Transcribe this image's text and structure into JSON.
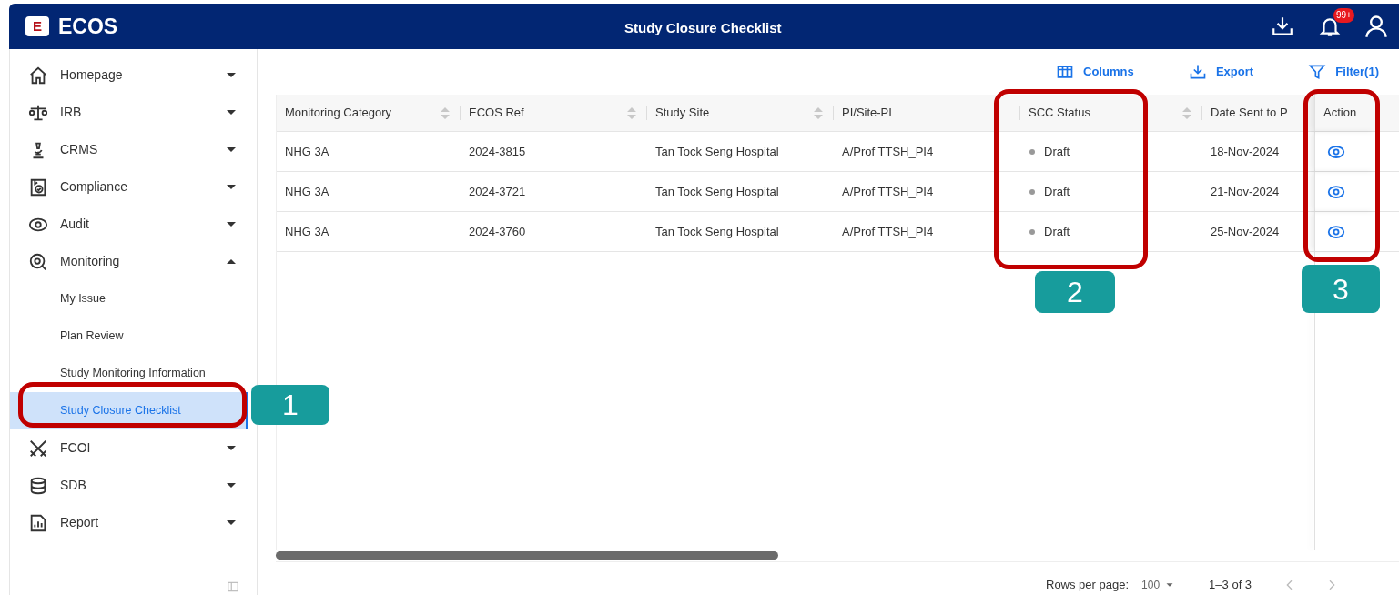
{
  "app": {
    "logo_letter": "E",
    "name": "ECOS",
    "title": "Study Closure Checklist",
    "notifications": "99+"
  },
  "sidebar": {
    "items": [
      {
        "label": "Homepage",
        "expanded": false
      },
      {
        "label": "IRB",
        "expanded": false
      },
      {
        "label": "CRMS",
        "expanded": false
      },
      {
        "label": "Compliance",
        "expanded": false
      },
      {
        "label": "Audit",
        "expanded": false
      },
      {
        "label": "Monitoring",
        "expanded": true,
        "children": [
          {
            "label": "My Issue",
            "selected": false
          },
          {
            "label": "Plan Review",
            "selected": false
          },
          {
            "label": "Study Monitoring Information",
            "selected": false
          },
          {
            "label": "Study Closure Checklist",
            "selected": true
          }
        ]
      },
      {
        "label": "FCOI",
        "expanded": false
      },
      {
        "label": "SDB",
        "expanded": false
      },
      {
        "label": "Report",
        "expanded": false
      }
    ]
  },
  "toolbar": [
    "Columns",
    "Export",
    "Filter(1)"
  ],
  "table": {
    "columns": [
      {
        "label": "Monitoring Category",
        "sortable": true
      },
      {
        "label": "ECOS Ref",
        "sortable": true
      },
      {
        "label": "Study Site",
        "sortable": true
      },
      {
        "label": "PI/Site-PI",
        "sortable": false
      },
      {
        "label": "SCC Status",
        "sortable": true
      },
      {
        "label": "Date Sent to P",
        "sortable": false
      },
      {
        "label": "Action",
        "sortable": false
      }
    ],
    "rows": [
      [
        "NHG 3A",
        "2024-3815",
        "Tan Tock Seng Hospital",
        "A/Prof TTSH_PI4",
        "Draft",
        "18-Nov-2024"
      ],
      [
        "NHG 3A",
        "2024-3721",
        "Tan Tock Seng Hospital",
        "A/Prof TTSH_PI4",
        "Draft",
        "21-Nov-2024"
      ],
      [
        "NHG 3A",
        "2024-3760",
        "Tan Tock Seng Hospital",
        "A/Prof TTSH_PI4",
        "Draft",
        "25-Nov-2024"
      ]
    ]
  },
  "pagination": {
    "rows_per_page_label": "Rows per page:",
    "rows_per_page": "100",
    "range": "1–3 of 3"
  },
  "annotations": [
    {
      "label": "1"
    },
    {
      "label": "2"
    },
    {
      "label": "3"
    }
  ]
}
